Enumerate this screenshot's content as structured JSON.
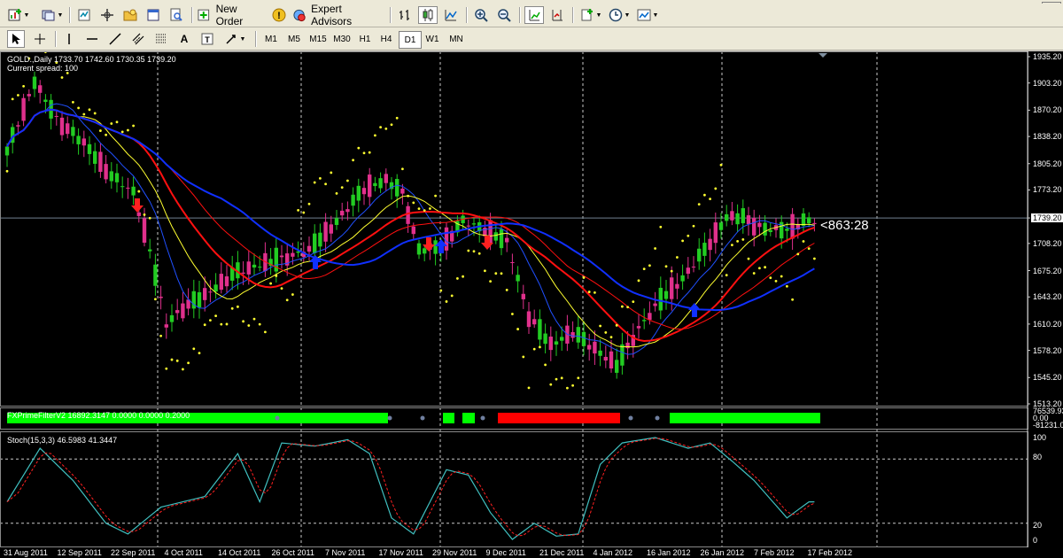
{
  "toolbar": {
    "new_order_label": "New Order",
    "expert_advisors_label": "Expert Advisors",
    "timeframes": [
      "M1",
      "M5",
      "M15",
      "M30",
      "H1",
      "H4",
      "D1",
      "W1",
      "MN"
    ],
    "active_timeframe": "D1"
  },
  "chart": {
    "header": "GOLD.,Daily  1733.70 1742.60 1730.35 1739.20",
    "spread": "Current spread: 100",
    "current_price": "1739.20",
    "floating_label": "<863:28",
    "price_labels": [
      "1935.20",
      "1903.20",
      "1870.20",
      "1838.20",
      "1805.20",
      "1773.20",
      "1739.20",
      "1708.20",
      "1675.20",
      "1643.20",
      "1610.20",
      "1578.20",
      "1545.20",
      "1513.20"
    ],
    "date_labels": [
      "31 Aug 2011",
      "12 Sep 2011",
      "22 Sep 2011",
      "4 Oct 2011",
      "14 Oct 2011",
      "26 Oct 2011",
      "7 Nov 2011",
      "17 Nov 2011",
      "29 Nov 2011",
      "9 Dec 2011",
      "21 Dec 2011",
      "4 Jan 2012",
      "16 Jan 2012",
      "26 Jan 2012",
      "7 Feb 2012",
      "17 Feb 2012"
    ]
  },
  "indicator1": {
    "label": "FXPrimeFilterV2 16892.3147 0.0000 0.0000 0.2000",
    "scale_top": "76539.93",
    "scale_zero": "0.00",
    "scale_bottom": "-81231.00"
  },
  "stoch": {
    "label": "Stoch(15,3,3) 46.5983 41.3447",
    "levels": [
      "100",
      "80",
      "20",
      "0"
    ]
  },
  "colors": {
    "bull": "#22cc22",
    "bear": "#e0308c",
    "ma_red": "#ff1010",
    "ma_blue": "#1030ff",
    "ma_yellow": "#ffff30",
    "sar": "#ffff30",
    "stoch_main": "#40c0c0",
    "stoch_signal": "#ff2020"
  }
}
